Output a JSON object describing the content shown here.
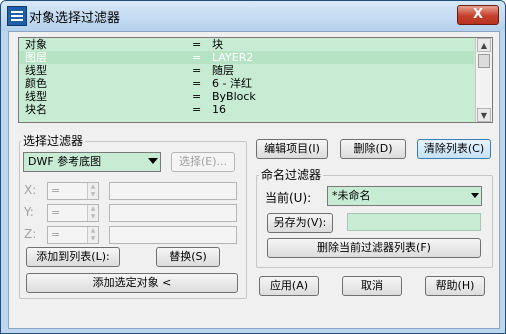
{
  "window": {
    "title": "对象选择过滤器",
    "close_label": "X"
  },
  "list": {
    "rows": [
      {
        "name": "对象",
        "op": "=",
        "value": "块",
        "selected": false
      },
      {
        "name": "图层",
        "op": "=",
        "value": "LAYER2",
        "selected": true
      },
      {
        "name": "线型",
        "op": "=",
        "value": "随层",
        "selected": false
      },
      {
        "name": "颜色",
        "op": "=",
        "value": "6 - 洋红",
        "selected": false
      },
      {
        "name": "线型",
        "op": "=",
        "value": "ByBlock",
        "selected": false
      },
      {
        "name": "块名",
        "op": "=",
        "value": "16",
        "selected": false
      }
    ]
  },
  "filter_group": {
    "label": "选择过滤器",
    "combo_value": "DWF 参考底图",
    "select_button": "选择(E)...",
    "x_label": "X:",
    "y_label": "Y:",
    "z_label": "Z:",
    "op_value": "=",
    "add_to_list": "添加到列表(L):",
    "replace": "替换(S)",
    "add_selected": "添加选定对象 <"
  },
  "actions": {
    "edit_item": "编辑项目(I)",
    "delete": "删除(D)",
    "clear_list": "清除列表(C)"
  },
  "named_group": {
    "label": "命名过滤器",
    "current_label": "当前(U):",
    "current_value": "*未命名",
    "save_as": "另存为(V):",
    "delete_current": "删除当前过滤器列表(F)"
  },
  "footer": {
    "apply": "应用(A)",
    "cancel": "取消",
    "help": "帮助(H)"
  }
}
